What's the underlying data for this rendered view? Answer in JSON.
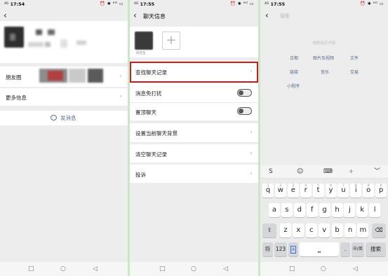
{
  "status": {
    "time": "17:55",
    "time_left": "17:54",
    "net": "4G",
    "icons": "⏰ ✱ ᴴᴰ ▭"
  },
  "panel1": {
    "back": "‹",
    "moments_label": "朋友圈",
    "more_info_label": "更多信息",
    "send_message_label": "发消息",
    "chevron": "›"
  },
  "panel2": {
    "back": "‹",
    "title": "聊天信息",
    "member_name": "阿佳生",
    "add_glyph": "+",
    "items": {
      "find_history": "查找聊天记录",
      "mute": "消息免打扰",
      "pin": "置顶聊天",
      "set_background": "设置当前聊天背景",
      "clear_history": "清空聊天记录",
      "report": "投诉"
    },
    "highlight_color": "#c32121",
    "chevron": "›"
  },
  "panel3": {
    "back": "‹",
    "search_placeholder": "搜索",
    "hint": "搜索指定内容",
    "categories": {
      "date": "日期",
      "media": "图片及视频",
      "file": "文件",
      "link": "链接",
      "music": "音乐",
      "trade": "交易",
      "miniprogram": "小程序"
    },
    "toolbar": {
      "logo": "S",
      "emoji": "☺",
      "keyboard": "⌨",
      "cursor": "·I·",
      "collapse": "﹀"
    },
    "keys": {
      "row1": [
        {
          "ch": "q",
          "sup": "1"
        },
        {
          "ch": "w",
          "sup": "2"
        },
        {
          "ch": "e",
          "sup": "3"
        },
        {
          "ch": "r",
          "sup": "4"
        },
        {
          "ch": "t",
          "sup": "5"
        },
        {
          "ch": "y",
          "sup": "6"
        },
        {
          "ch": "u",
          "sup": "7"
        },
        {
          "ch": "i",
          "sup": "8"
        },
        {
          "ch": "o",
          "sup": "9"
        },
        {
          "ch": "p",
          "sup": "0"
        }
      ],
      "row2": [
        "a",
        "s",
        "d",
        "f",
        "g",
        "h",
        "j",
        "k",
        "l"
      ],
      "row3": [
        "z",
        "x",
        "c",
        "v",
        "b",
        "n",
        "m"
      ],
      "shift": "⇧",
      "backspace": "⌫",
      "symbol": "符",
      "num": "123",
      "lang_box": "A",
      "space": "⎵",
      "period": ".",
      "lang": "中/英",
      "search": "搜索"
    }
  },
  "nav": {
    "square": "□",
    "circle": "○",
    "back": "◁"
  }
}
